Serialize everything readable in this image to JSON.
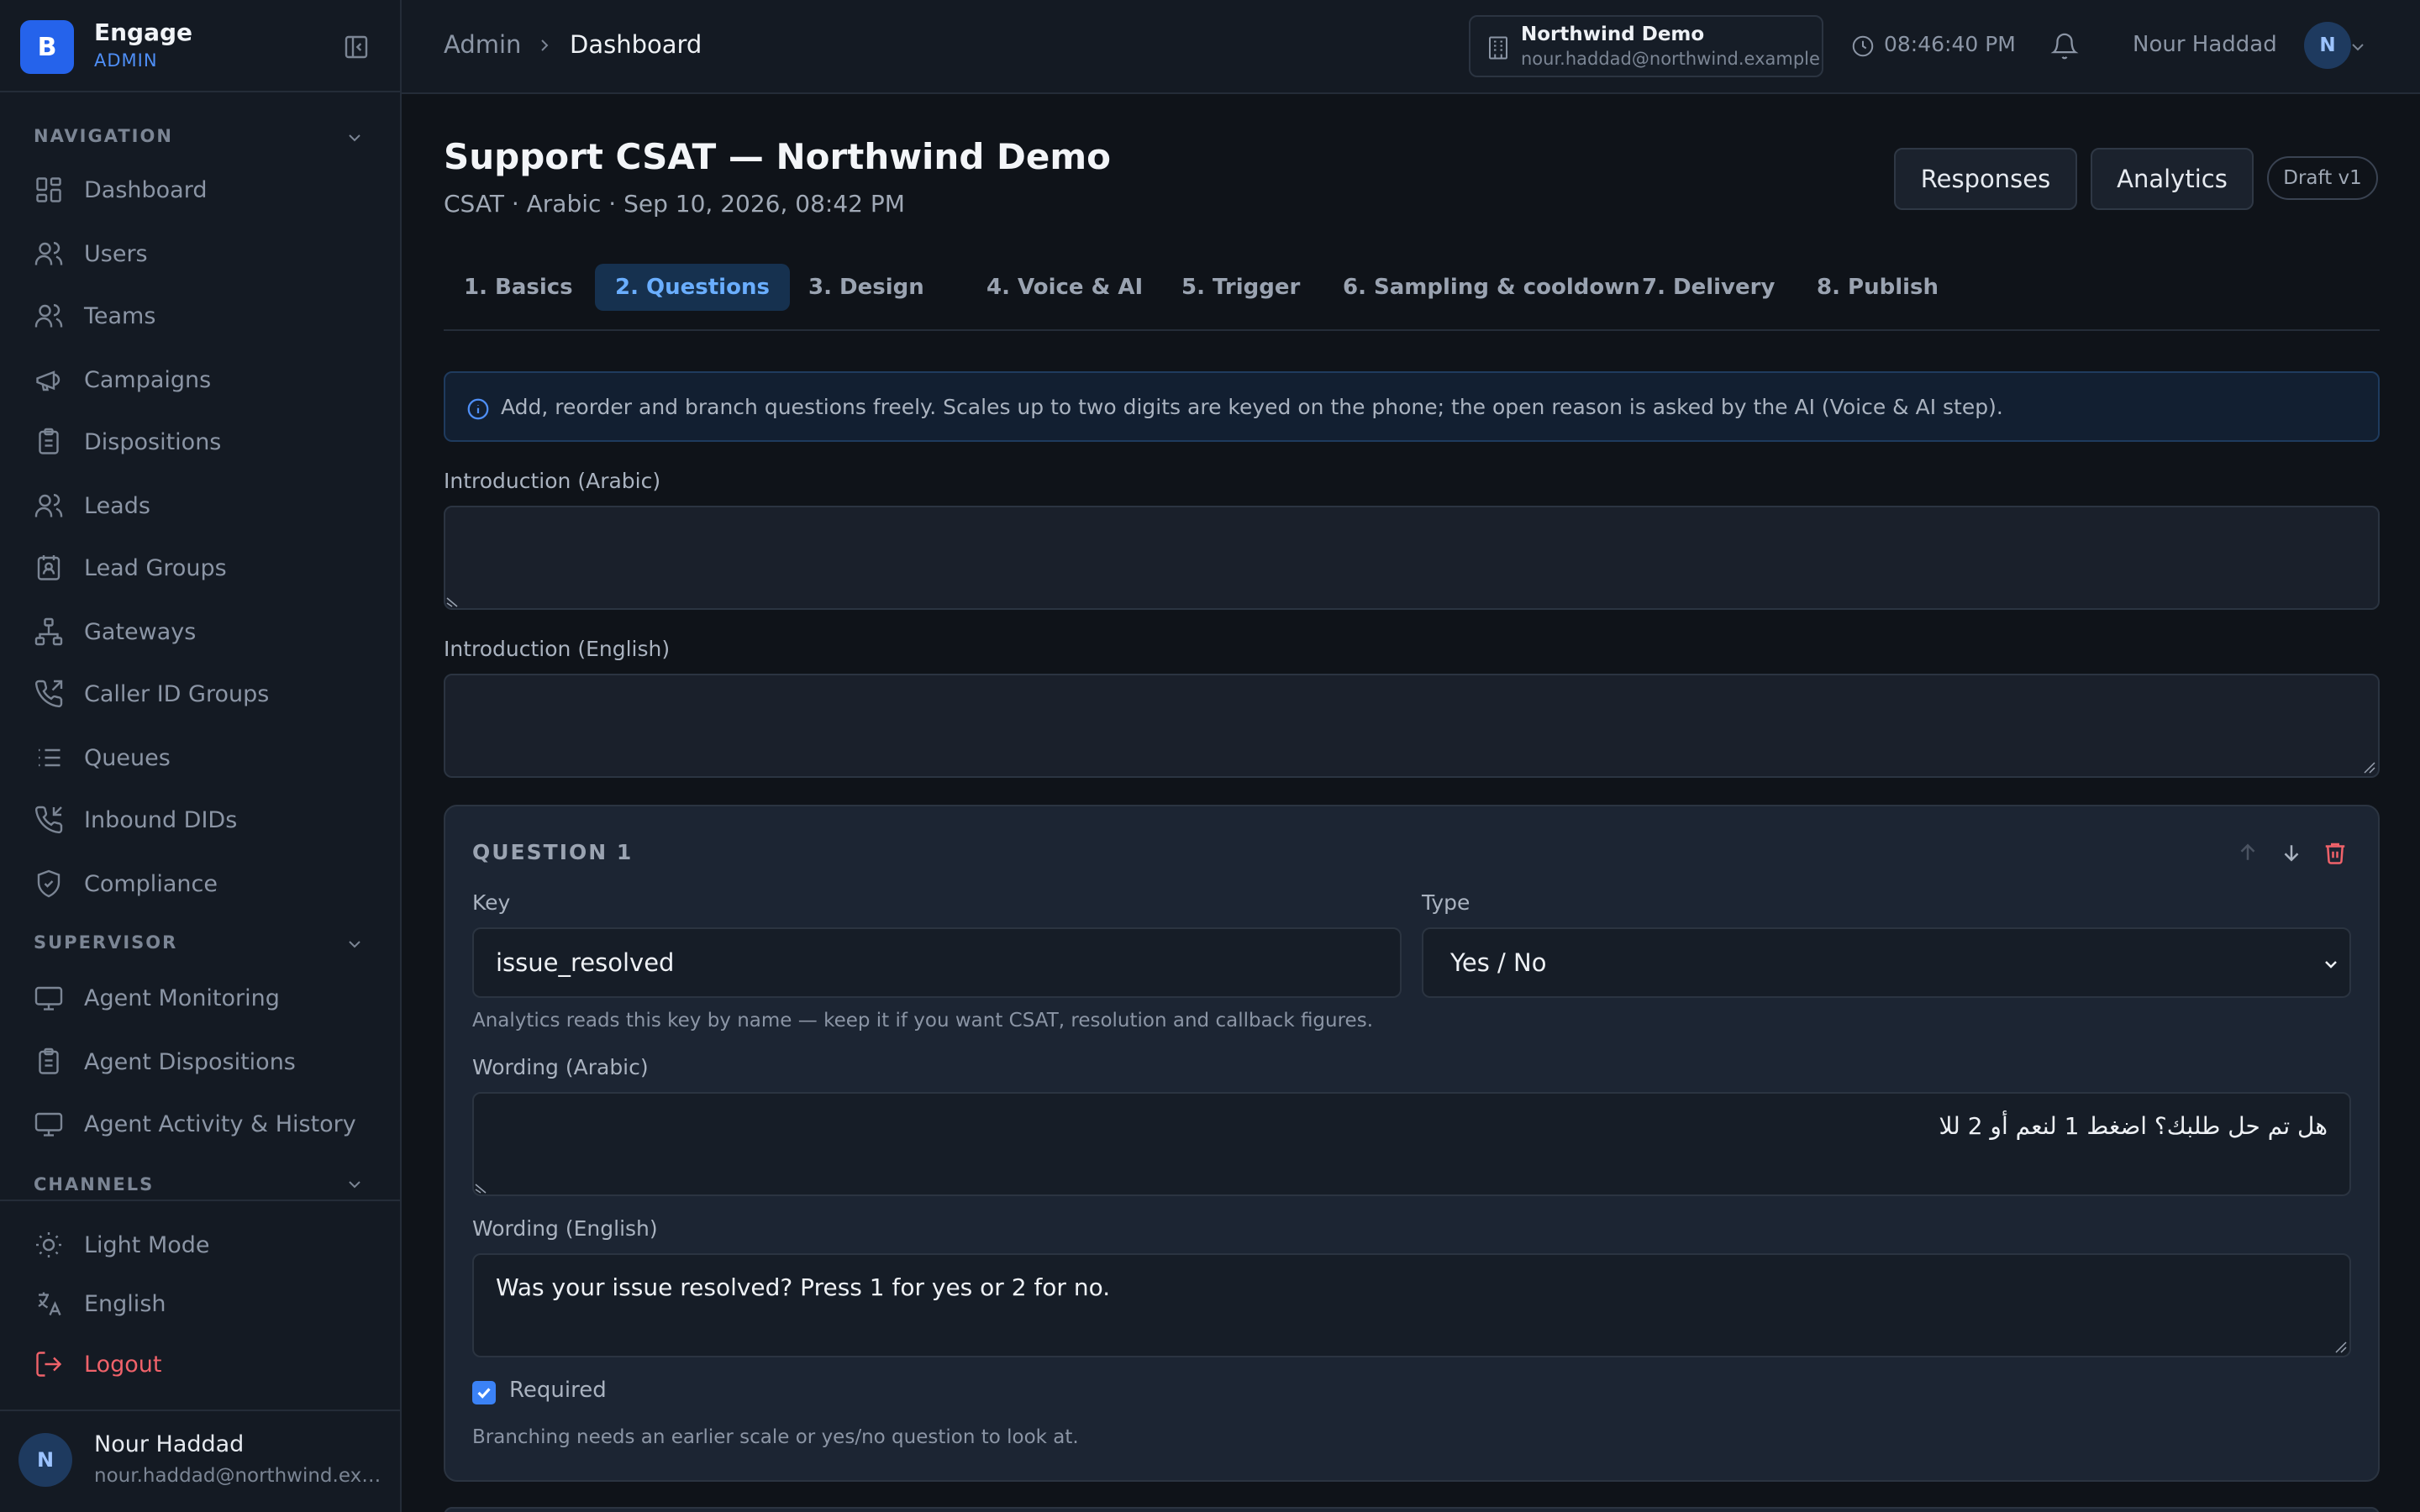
{
  "brand": {
    "logo_letter": "B",
    "name": "Engage",
    "role": "ADMIN"
  },
  "sidebar": {
    "sections": [
      {
        "title": "NAVIGATION"
      },
      {
        "title": "SUPERVISOR"
      },
      {
        "title": "CHANNELS"
      }
    ],
    "items": [
      {
        "label": "Dashboard",
        "icon": "dashboard-icon"
      },
      {
        "label": "Users",
        "icon": "users-icon"
      },
      {
        "label": "Teams",
        "icon": "teams-icon"
      },
      {
        "label": "Campaigns",
        "icon": "megaphone-icon"
      },
      {
        "label": "Dispositions",
        "icon": "clipboard-icon"
      },
      {
        "label": "Leads",
        "icon": "leads-icon"
      },
      {
        "label": "Lead Groups",
        "icon": "contact-card-icon"
      },
      {
        "label": "Gateways",
        "icon": "network-icon"
      },
      {
        "label": "Caller ID Groups",
        "icon": "phone-outgoing-icon"
      },
      {
        "label": "Queues",
        "icon": "list-icon"
      },
      {
        "label": "Inbound DIDs",
        "icon": "phone-incoming-icon"
      },
      {
        "label": "Compliance",
        "icon": "shield-check-icon"
      }
    ],
    "supervisor_items": [
      {
        "label": "Agent Monitoring",
        "icon": "monitor-icon"
      },
      {
        "label": "Agent Dispositions",
        "icon": "clipboard-icon"
      },
      {
        "label": "Agent Activity & History",
        "icon": "monitor-icon"
      }
    ],
    "bottom": {
      "light_mode": "Light Mode",
      "language": "English",
      "logout": "Logout"
    },
    "user": {
      "initial": "N",
      "name": "Nour Haddad",
      "email": "nour.haddad@northwind.exa..."
    }
  },
  "topbar": {
    "breadcrumb": {
      "root": "Admin",
      "current": "Dashboard"
    },
    "tenant": {
      "name": "Northwind Demo",
      "email": "nour.haddad@northwind.example"
    },
    "clock": "08:46:40 PM",
    "user": {
      "name": "Nour Haddad",
      "initial": "N"
    }
  },
  "header": {
    "title": "Support CSAT — Northwind Demo",
    "subtitle": "CSAT · Arabic · Sep 10, 2026, 08:42 PM",
    "responses_button": "Responses",
    "analytics_button": "Analytics",
    "draft_badge": "Draft v1"
  },
  "steps": [
    {
      "label": "1. Basics"
    },
    {
      "label": "2. Questions",
      "active": true
    },
    {
      "label": "3. Design"
    },
    {
      "label": "4. Voice & AI"
    },
    {
      "label": "5. Trigger"
    },
    {
      "label": "6. Sampling & cooldown"
    },
    {
      "label": "7. Delivery"
    },
    {
      "label": "8. Publish"
    }
  ],
  "info": "Add, reorder and branch questions freely. Scales up to two digits are keyed on the phone; the open reason is asked by the AI (Voice & AI step).",
  "intro": {
    "arabic_label": "Introduction (Arabic)",
    "arabic_value": "",
    "english_label": "Introduction (English)",
    "english_value": ""
  },
  "question": {
    "title": "QUESTION 1",
    "key_label": "Key",
    "key_value": "issue_resolved",
    "type_label": "Type",
    "type_value": "Yes / No",
    "key_hint": "Analytics reads this key by name — keep it if you want CSAT, resolution and callback figures.",
    "wording_ar_label": "Wording (Arabic)",
    "wording_ar_value": "هل تم حل طلبك؟ اضغط 1 لنعم أو 2 للا",
    "wording_en_label": "Wording (English)",
    "wording_en_value": "Was your issue resolved? Press 1 for yes or 2 for no.",
    "required_label": "Required",
    "required": true,
    "branch_hint": "Branching needs an earlier scale or yes/no question to look at."
  },
  "colors": {
    "accent": "#2563eb",
    "active_tab_bg": "#16314f",
    "active_tab_text": "#6aaeff",
    "danger": "#f0626a",
    "background": "#0f1319"
  }
}
